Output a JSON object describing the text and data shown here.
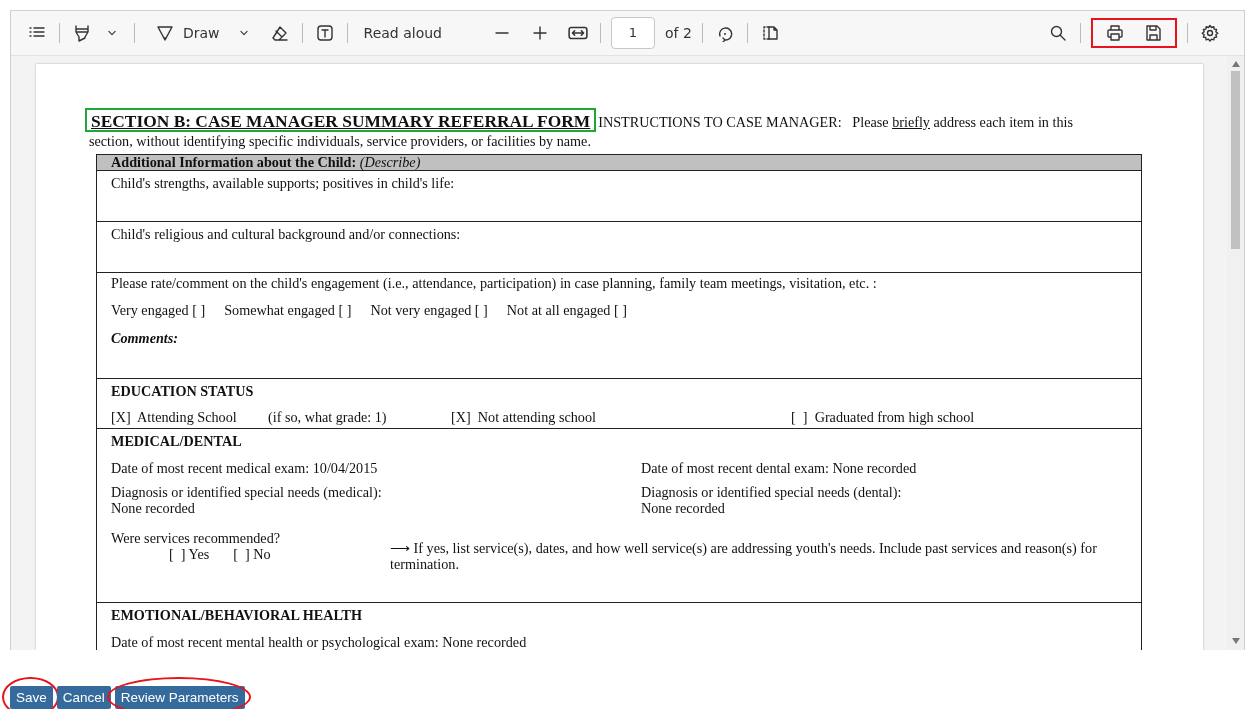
{
  "toolbar": {
    "draw_label": "Draw",
    "read_aloud_label": "Read aloud",
    "page_number": "1",
    "page_count": "of 2",
    "print_save_highlighted": true
  },
  "document": {
    "title": "SECTION B: CASE MANAGER SUMMARY REFERRAL FORM",
    "title_highlighted": true,
    "instructions": {
      "before": "INSTRUCTIONS TO CASE MANAGER:   Please ",
      "underlined": "briefly",
      "after": " address each item in this section, without identifying specific individuals, service providers, or facilities by name."
    },
    "table_header": "**Additional Information about the Child:** *(Describe)*",
    "rows": [
      {
        "kind": "prompt",
        "text": "Child's strengths, available supports; positives in child's life:"
      },
      {
        "kind": "prompt",
        "text": "Child's religious and cultural background and/or connections:"
      },
      {
        "kind": "engagement",
        "text": "Please rate/comment on the child's engagement (i.e., attendance, participation) in case planning, family team meetings, visitation, etc. :",
        "options": [
          "Very engaged  [  ]",
          "Somewhat engaged [  ]",
          "Not very engaged [  ]",
          "Not at all engaged [  ]"
        ],
        "comments_label": "Comments:"
      },
      {
        "kind": "education",
        "heading": "EDUCATION STATUS",
        "options": [
          "[X]  Attending School",
          "(if so, what grade: 1)",
          "[X]  Not attending school",
          "[  ]  Graduated from high school"
        ]
      },
      {
        "kind": "medical",
        "heading": "MEDICAL/DENTAL",
        "left": [
          "Date of most recent medical exam: 10/04/2015",
          "Diagnosis or identified special needs (medical):",
          "None recorded"
        ],
        "right": [
          "Date of most recent dental exam: None recorded",
          "Diagnosis or identified special needs (dental):",
          "None recorded"
        ],
        "question": "Were services recommended?",
        "answers": [
          "[  ] Yes",
          "[  ] No"
        ],
        "follow_up": "⟶ If yes, list service(s), dates, and how well service(s) are addressing youth's needs. Include past services and reason(s) for termination."
      },
      {
        "kind": "emotional",
        "heading": "EMOTIONAL/BEHAVIORAL HEALTH",
        "text": "Date of most recent mental health or psychological exam: None recorded"
      }
    ]
  },
  "buttons": [
    {
      "label": "Save",
      "circled": true
    },
    {
      "label": "Cancel",
      "circled": false
    },
    {
      "label": "Review Parameters",
      "circled": true
    }
  ]
}
